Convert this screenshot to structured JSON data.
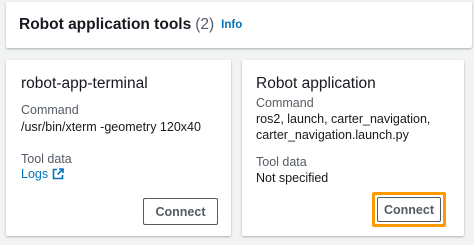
{
  "header": {
    "title": "Robot application tools",
    "count": "(2)",
    "info_label": "Info"
  },
  "cards": [
    {
      "title": "robot-app-terminal",
      "command_label": "Command",
      "command_lines": [
        "/usr/bin/xterm -geometry 120x40"
      ],
      "tool_data_label": "Tool data",
      "tool_data_value": "Logs",
      "tool_data_icon": "external-link-icon",
      "button_label": "Connect"
    },
    {
      "title": "Robot application",
      "command_label": "Command",
      "command_lines": [
        "ros2, launch, carter_navigation,",
        "carter_navigation.launch.py"
      ],
      "tool_data_label": "Tool data",
      "tool_data_value": "Not specified",
      "button_label": "Connect"
    }
  ],
  "colors": {
    "link": "#0073bb",
    "highlight": "#ff9900",
    "background": "#f2f3f3"
  }
}
